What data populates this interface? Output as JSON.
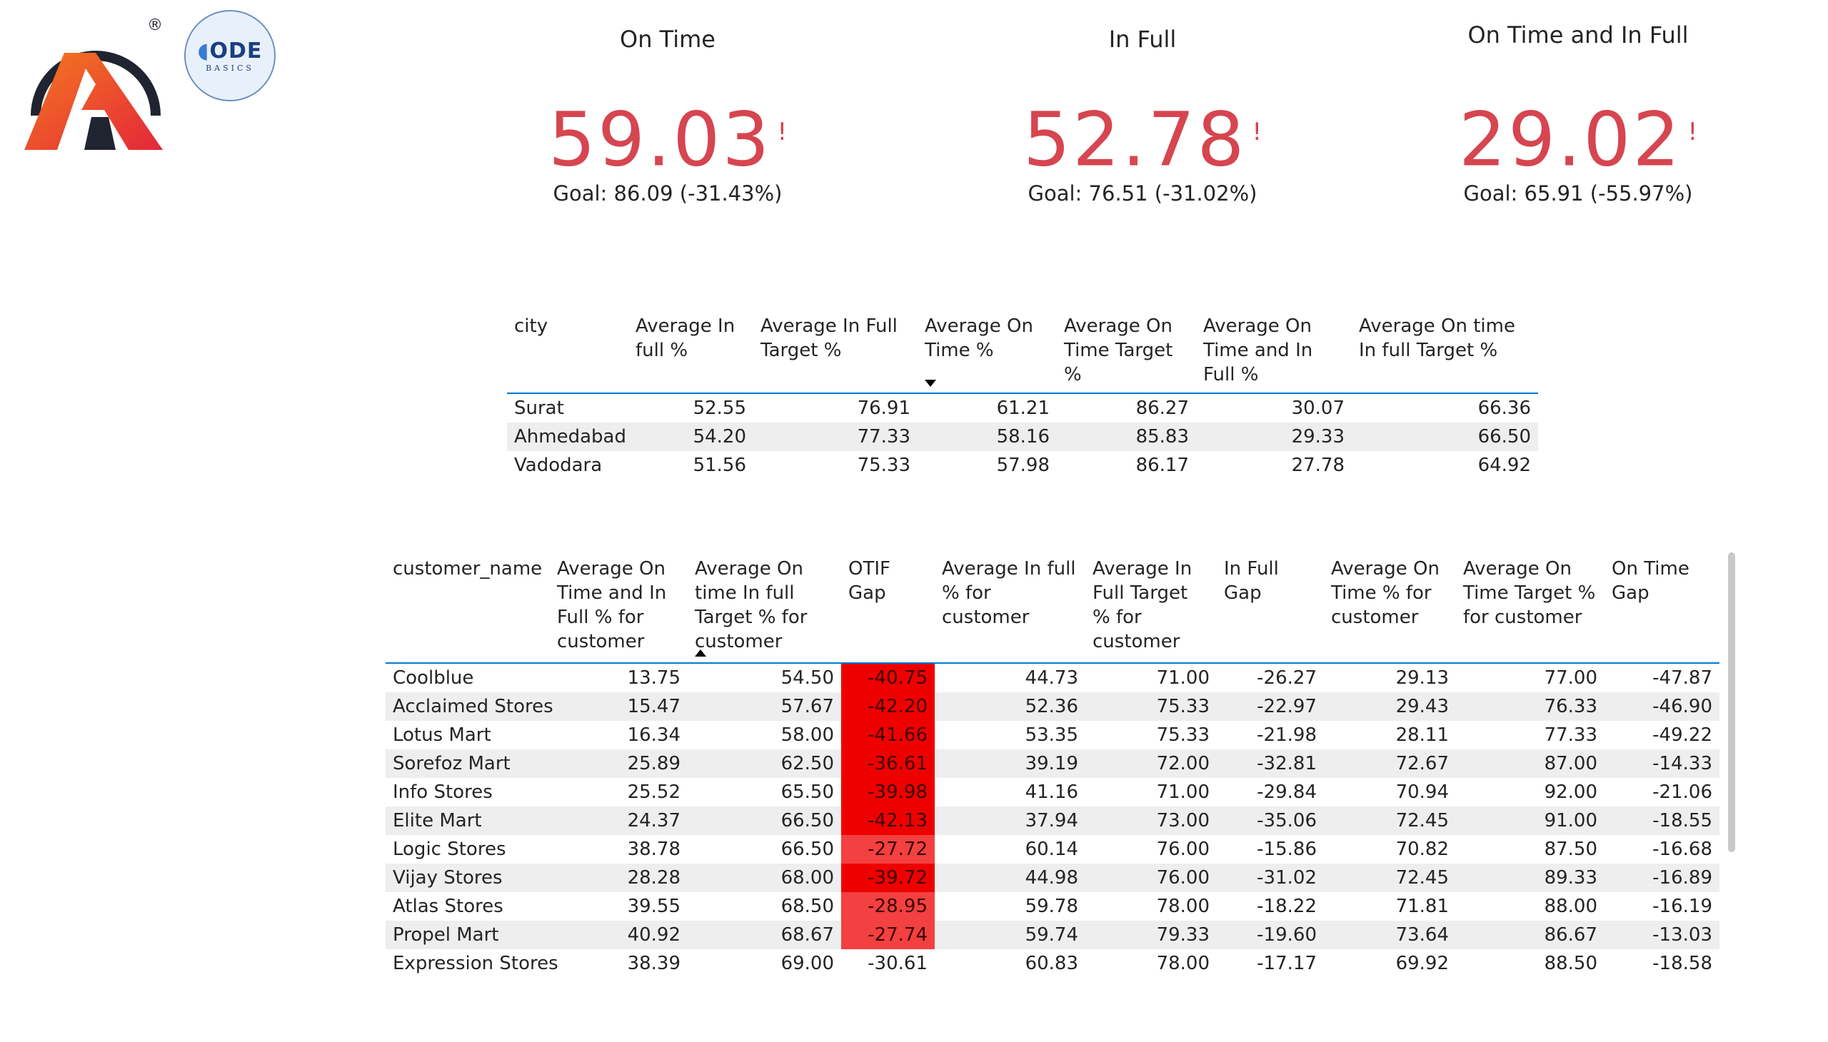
{
  "logos": {
    "atliq_mark": "®",
    "codebasics_word": "ODE",
    "codebasics_sub": "BASICS"
  },
  "kpis": [
    {
      "title": "On Time",
      "value": "59.03",
      "alert": "!",
      "goal": "Goal: 86.09 (-31.43%)"
    },
    {
      "title": "In Full",
      "value": "52.78",
      "alert": "!",
      "goal": "Goal: 76.51 (-31.02%)"
    },
    {
      "title": "On Time and In Full",
      "value": "29.02",
      "alert": "!",
      "goal": "Goal: 65.91 (-55.97%)"
    }
  ],
  "city_table": {
    "headers": [
      "city",
      "Average In full %",
      "Average In Full Target %",
      "Average On Time %",
      "Average On Time Target %",
      "Average On Time and In Full %",
      "Average On time In full Target %"
    ],
    "sorted_column": 3,
    "sort_direction": "descending",
    "rows": [
      [
        "Surat",
        "52.55",
        "76.91",
        "61.21",
        "86.27",
        "30.07",
        "66.36"
      ],
      [
        "Ahmedabad",
        "54.20",
        "77.33",
        "58.16",
        "85.83",
        "29.33",
        "66.50"
      ],
      [
        "Vadodara",
        "51.56",
        "75.33",
        "57.98",
        "86.17",
        "27.78",
        "64.92"
      ]
    ]
  },
  "customer_table": {
    "headers": [
      "customer_name",
      "Average On Time and In Full % for customer",
      "Average On time In full Target % for customer",
      "OTIF Gap",
      "Average In full % for customer",
      "Average In Full Target % for customer",
      "In Full Gap",
      "Average On Time % for customer",
      "Average On Time Target % for customer",
      "On Time Gap"
    ],
    "sorted_column": 2,
    "sort_direction": "ascending",
    "gap_colors": {
      "strong": "#ee0000",
      "medium": "#f34040",
      "none": "#ffffff"
    },
    "rows": [
      {
        "cells": [
          "Coolblue",
          "13.75",
          "54.50",
          "-40.75",
          "44.73",
          "71.00",
          "-26.27",
          "29.13",
          "77.00",
          "-47.87"
        ],
        "gap_level": "strong"
      },
      {
        "cells": [
          "Acclaimed Stores",
          "15.47",
          "57.67",
          "-42.20",
          "52.36",
          "75.33",
          "-22.97",
          "29.43",
          "76.33",
          "-46.90"
        ],
        "gap_level": "strong"
      },
      {
        "cells": [
          "Lotus Mart",
          "16.34",
          "58.00",
          "-41.66",
          "53.35",
          "75.33",
          "-21.98",
          "28.11",
          "77.33",
          "-49.22"
        ],
        "gap_level": "strong"
      },
      {
        "cells": [
          "Sorefoz Mart",
          "25.89",
          "62.50",
          "-36.61",
          "39.19",
          "72.00",
          "-32.81",
          "72.67",
          "87.00",
          "-14.33"
        ],
        "gap_level": "strong"
      },
      {
        "cells": [
          "Info Stores",
          "25.52",
          "65.50",
          "-39.98",
          "41.16",
          "71.00",
          "-29.84",
          "70.94",
          "92.00",
          "-21.06"
        ],
        "gap_level": "strong"
      },
      {
        "cells": [
          "Elite Mart",
          "24.37",
          "66.50",
          "-42.13",
          "37.94",
          "73.00",
          "-35.06",
          "72.45",
          "91.00",
          "-18.55"
        ],
        "gap_level": "strong"
      },
      {
        "cells": [
          "Logic Stores",
          "38.78",
          "66.50",
          "-27.72",
          "60.14",
          "76.00",
          "-15.86",
          "70.82",
          "87.50",
          "-16.68"
        ],
        "gap_level": "medium"
      },
      {
        "cells": [
          "Vijay Stores",
          "28.28",
          "68.00",
          "-39.72",
          "44.98",
          "76.00",
          "-31.02",
          "72.45",
          "89.33",
          "-16.89"
        ],
        "gap_level": "strong"
      },
      {
        "cells": [
          "Atlas Stores",
          "39.55",
          "68.50",
          "-28.95",
          "59.78",
          "78.00",
          "-18.22",
          "71.81",
          "88.00",
          "-16.19"
        ],
        "gap_level": "medium"
      },
      {
        "cells": [
          "Propel Mart",
          "40.92",
          "68.67",
          "-27.74",
          "59.74",
          "79.33",
          "-19.60",
          "73.64",
          "86.67",
          "-13.03"
        ],
        "gap_level": "medium"
      },
      {
        "cells": [
          "Expression Stores",
          "38.39",
          "69.00",
          "-30.61",
          "60.83",
          "78.00",
          "-17.17",
          "69.92",
          "88.50",
          "-18.58"
        ],
        "gap_level": "none"
      }
    ]
  }
}
